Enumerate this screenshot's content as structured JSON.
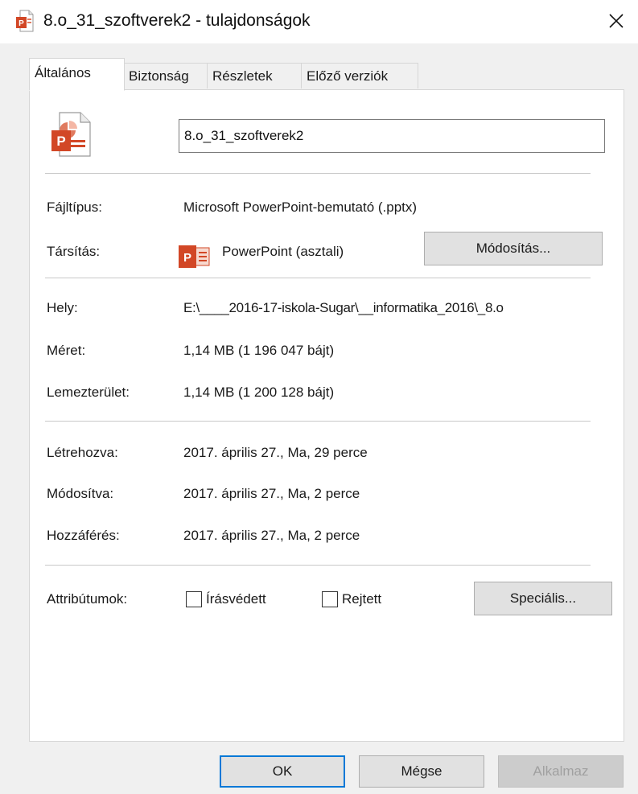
{
  "window": {
    "title": "8.o_31_szoftverek2 - tulajdonságok",
    "icon": "powerpoint-file-icon",
    "close_icon": "close-icon"
  },
  "tabs": [
    {
      "label": "Általános",
      "active": true
    },
    {
      "label": "Biztonság",
      "active": false
    },
    {
      "label": "Részletek",
      "active": false
    },
    {
      "label": "Előző verziók",
      "active": false
    }
  ],
  "general": {
    "file_name": "8.o_31_szoftverek2",
    "file_type_label": "Fájltípus:",
    "file_type_value": "Microsoft PowerPoint-bemutató (.pptx)",
    "opens_with_label": "Társítás:",
    "opens_with_value": "PowerPoint (asztali)",
    "change_button": "Módosítás...",
    "location_label": "Hely:",
    "location_value": "E:\\____2016-17-iskola-Sugar\\__informatika_2016\\_8.o",
    "size_label": "Méret:",
    "size_value": "1,14 MB (1 196 047 bájt)",
    "disk_size_label": "Lemezterület:",
    "disk_size_value": "1,14 MB (1 200 128 bájt)",
    "created_label": "Létrehozva:",
    "created_value": "2017. április 27., Ma, 29 perce",
    "modified_label": "Módosítva:",
    "modified_value": "2017. április 27., Ma, 2 perce",
    "accessed_label": "Hozzáférés:",
    "accessed_value": "2017. április 27., Ma, 2 perce",
    "attributes_label": "Attribútumok:",
    "readonly_label": "Írásvédett",
    "readonly_checked": false,
    "hidden_label": "Rejtett",
    "hidden_checked": false,
    "advanced_button": "Speciális..."
  },
  "footer": {
    "ok": "OK",
    "cancel": "Mégse",
    "apply": "Alkalmaz",
    "apply_enabled": false
  },
  "colors": {
    "powerpoint_red": "#d24726",
    "accent_blue": "#0078d7",
    "dialog_bg": "#f0f0f0"
  }
}
